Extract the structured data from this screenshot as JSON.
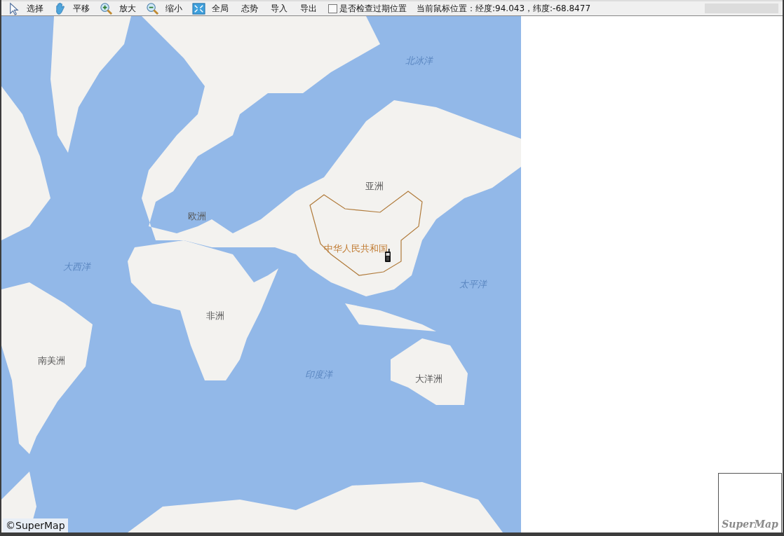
{
  "toolbar": {
    "tools": [
      {
        "label": "选择",
        "kind": "icon"
      },
      {
        "label": "平移",
        "kind": "icon"
      },
      {
        "label": "放大",
        "kind": "icon"
      },
      {
        "label": "缩小",
        "kind": "icon"
      },
      {
        "label": "全局",
        "kind": "icon"
      },
      {
        "label": "态势",
        "kind": "text"
      },
      {
        "label": "导入",
        "kind": "text"
      },
      {
        "label": "导出",
        "kind": "text"
      }
    ],
    "checkbox": {
      "label": "是否检查过期位置",
      "checked": false
    },
    "status": "当前鼠标位置：经度:94.043，纬度:-68.8477"
  },
  "map": {
    "labels": [
      {
        "text": "北冰洋",
        "kind": "ocean"
      },
      {
        "text": "亚洲",
        "kind": "continent"
      },
      {
        "text": "欧洲",
        "kind": "continent"
      },
      {
        "text": "中华人民共和国",
        "kind": "country"
      },
      {
        "text": "大西洋",
        "kind": "ocean"
      },
      {
        "text": "太平洋",
        "kind": "ocean"
      },
      {
        "text": "非洲",
        "kind": "continent"
      },
      {
        "text": "南美洲",
        "kind": "continent"
      },
      {
        "text": "印度洋",
        "kind": "ocean"
      },
      {
        "text": "大洋洲",
        "kind": "continent"
      }
    ],
    "copyright": "©SuperMap"
  },
  "overview": {
    "logo": "SuperMap"
  }
}
